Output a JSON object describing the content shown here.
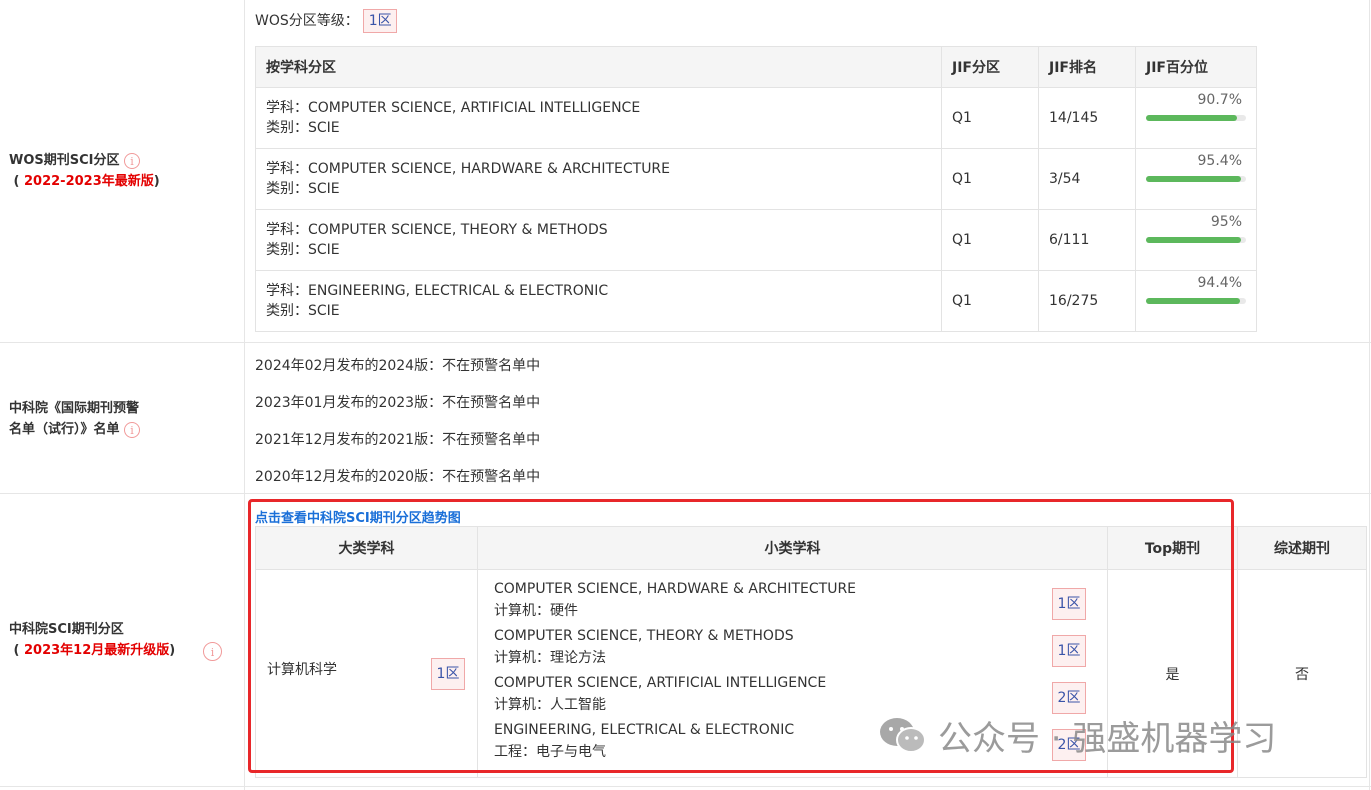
{
  "wos_section": {
    "label": "WOS期刊SCI分区",
    "edition": "2022-2023年最新版",
    "grade_label": "WOS分区等级：",
    "grade_value": "1区",
    "headers": [
      "按学科分区",
      "JIF分区",
      "JIF排名",
      "JIF百分位"
    ],
    "rows": [
      {
        "subject": "学科：COMPUTER SCIENCE, ARTIFICIAL INTELLIGENCE",
        "category": "类别：SCIE",
        "quartile": "Q1",
        "rank": "14/145",
        "percentile_text": "90.7%",
        "percentile": 90.7
      },
      {
        "subject": "学科：COMPUTER SCIENCE, HARDWARE & ARCHITECTURE",
        "category": "类别：SCIE",
        "quartile": "Q1",
        "rank": "3/54",
        "percentile_text": "95.4%",
        "percentile": 95.4
      },
      {
        "subject": "学科：COMPUTER SCIENCE, THEORY & METHODS",
        "category": "类别：SCIE",
        "quartile": "Q1",
        "rank": "6/111",
        "percentile_text": "95%",
        "percentile": 95
      },
      {
        "subject": "学科：ENGINEERING, ELECTRICAL & ELECTRONIC",
        "category": "类别：SCIE",
        "quartile": "Q1",
        "rank": "16/275",
        "percentile_text": "94.4%",
        "percentile": 94.4
      }
    ]
  },
  "warning_section": {
    "label_line1": "中科院《国际期刊预警",
    "label_line2": "名单（试行）》名单",
    "items": [
      "2024年02月发布的2024版：不在预警名单中",
      "2023年01月发布的2023版：不在预警名单中",
      "2021年12月发布的2021版：不在预警名单中",
      "2020年12月发布的2020版：不在预警名单中"
    ]
  },
  "cas_section": {
    "label": "中科院SCI期刊分区",
    "edition": "2023年12月最新升级版",
    "trend_link": "点击查看中科院SCI期刊分区趋势图",
    "headers": [
      "大类学科",
      "小类学科",
      "Top期刊",
      "综述期刊"
    ],
    "major_subject": "计算机科学",
    "major_zone": "1区",
    "subcategories": [
      {
        "en": "COMPUTER SCIENCE, HARDWARE & ARCHITECTURE",
        "cn": "计算机：硬件",
        "zone": "1区"
      },
      {
        "en": "COMPUTER SCIENCE, THEORY & METHODS",
        "cn": "计算机：理论方法",
        "zone": "1区"
      },
      {
        "en": "COMPUTER SCIENCE, ARTIFICIAL INTELLIGENCE",
        "cn": "计算机：人工智能",
        "zone": "2区"
      },
      {
        "en": "ENGINEERING, ELECTRICAL & ELECTRONIC",
        "cn": "工程：电子与电气",
        "zone": "2区"
      }
    ],
    "top_journal": "是",
    "review_journal": "否"
  },
  "info_icon_glyph": "i",
  "watermark": {
    "text": "公众号 · 强盛机器学习"
  },
  "colors": {
    "accent_red": "#e30000",
    "bar_green": "#5cb85c",
    "link_blue": "#1a6fd8",
    "highlight_box": "#e8272a"
  }
}
